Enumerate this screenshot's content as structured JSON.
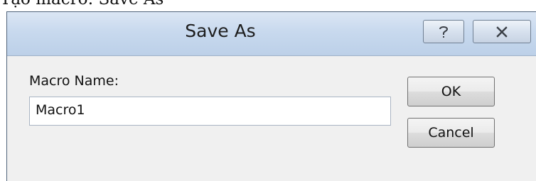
{
  "background_caption": "Tạo macro: Save As",
  "dialog": {
    "title": "Save As",
    "help_label": "?",
    "close_label": "✕",
    "macro_name_label": "Macro Name:",
    "macro_name_value": "Macro1",
    "ok_label": "OK",
    "cancel_label": "Cancel"
  },
  "colors": {
    "titlebar": "#c8d9ee",
    "dialog_background": "#f0f0f0",
    "input_border": "#a9b4c3",
    "button_border": "#707070"
  }
}
